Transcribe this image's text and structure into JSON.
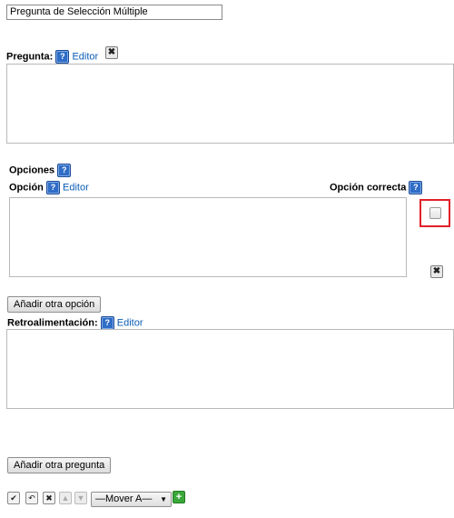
{
  "question": {
    "title_value": "Pregunta de Selección Múltiple",
    "label": "Pregunta:",
    "editor_link": "Editor"
  },
  "options": {
    "heading": "Opciones",
    "option_label": "Opción",
    "option_editor_link": "Editor",
    "correct_label": "Opción correcta",
    "add_option_button": "Añadir otra opción"
  },
  "feedback": {
    "label": "Retroalimentación:",
    "editor_link": "Editor"
  },
  "footer": {
    "add_question_button": "Añadir otra pregunta",
    "move_select_value": "—Mover A—"
  },
  "icons": {
    "help": "?",
    "close": "✖",
    "check": "✔",
    "undo": "↶",
    "up": "▲",
    "down": "▼",
    "add": "+"
  },
  "colors": {
    "highlight": "#e0202a",
    "link": "#0b5db5",
    "help_icon": "#2f6dc6"
  }
}
